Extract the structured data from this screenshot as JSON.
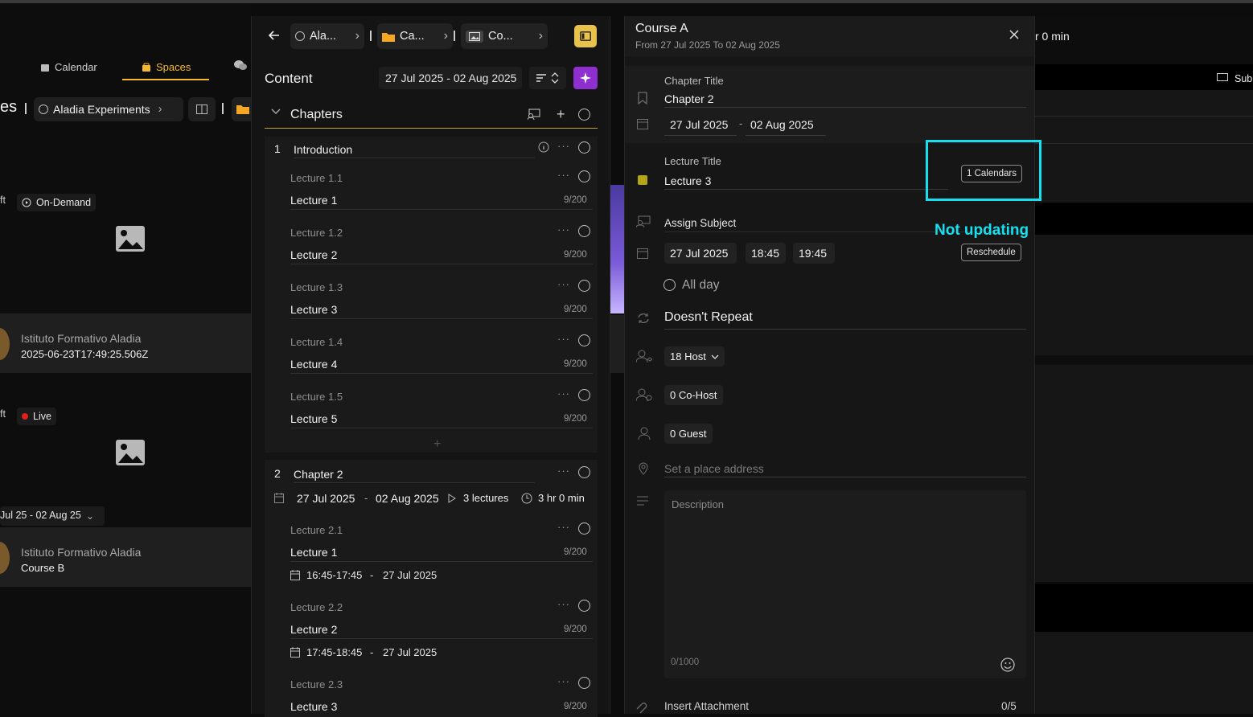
{
  "background": {
    "nav": {
      "calendar": "Calendar",
      "spaces": "Spaces"
    },
    "breadcrumb": {
      "title_fragment": "es",
      "space": "Aladia Experiments"
    },
    "items": [
      {
        "tag_prefix": "ft",
        "tag": "On-Demand",
        "org": "Istituto Formativo Aladia",
        "subtitle": "2025-06-23T17:49:25.506Z"
      },
      {
        "tag_prefix": "ft",
        "tag": "Live",
        "date_range": "Jul 25 - 02 Aug 25",
        "org": "Istituto Formativo Aladia",
        "subtitle": "Course B"
      }
    ],
    "right_fragments": {
      "duration": "r 0 min",
      "sub": "Sub"
    }
  },
  "middle": {
    "breadcrumbs": [
      "Ala...",
      "Ca...",
      "Co..."
    ],
    "header": {
      "title": "Content",
      "date_range": "27 Jul 2025 - 02 Aug 2025"
    },
    "chapters_label": "Chapters",
    "chapter1": {
      "number": "1",
      "title": "Introduction",
      "lectures": [
        {
          "code": "Lecture 1.1",
          "name": "Lecture 1",
          "count": "9/200"
        },
        {
          "code": "Lecture 1.2",
          "name": "Lecture 2",
          "count": "9/200"
        },
        {
          "code": "Lecture 1.3",
          "name": "Lecture 3",
          "count": "9/200"
        },
        {
          "code": "Lecture 1.4",
          "name": "Lecture 4",
          "count": "9/200"
        },
        {
          "code": "Lecture 1.5",
          "name": "Lecture 5",
          "count": "9/200"
        }
      ]
    },
    "chapter2": {
      "number": "2",
      "title": "Chapter 2",
      "start": "27 Jul 2025",
      "dash": "-",
      "end": "02 Aug 2025",
      "lectures_count": "3 lectures",
      "duration": "3 hr 0 min",
      "lectures": [
        {
          "code": "Lecture 2.1",
          "name": "Lecture 1",
          "count": "9/200",
          "time": "16:45-17:45",
          "dash": "-",
          "date": "27 Jul 2025"
        },
        {
          "code": "Lecture 2.2",
          "name": "Lecture 2",
          "count": "9/200",
          "time": "17:45-18:45",
          "dash": "-",
          "date": "27 Jul 2025"
        },
        {
          "code": "Lecture 2.3",
          "name": "Lecture 3",
          "count": "9/200"
        }
      ]
    }
  },
  "right": {
    "title": "Course A",
    "subtitle": "From 27 Jul 2025 To 02 Aug 2025",
    "chapter": {
      "label": "Chapter Title",
      "value": "Chapter 2",
      "start": "27 Jul 2025",
      "dash": "-",
      "end": "02 Aug 2025"
    },
    "lecture": {
      "label": "Lecture Title",
      "value": "Lecture 3",
      "calendars_button": "1 Calendars"
    },
    "assign_subject": "Assign Subject",
    "annotation": "Not updating",
    "schedule": {
      "date": "27 Jul 2025",
      "start": "18:45",
      "end": "19:45",
      "reschedule": "Reschedule"
    },
    "all_day": "All day",
    "repeat": "Doesn't Repeat",
    "host": "18  Host",
    "cohost": "0  Co-Host",
    "guest": "0  Guest",
    "place_placeholder": "Set a place address",
    "description_placeholder": "Description",
    "description_count": "0/1000",
    "attachment_label": "Insert Attachment",
    "attachment_count": "0/5"
  },
  "colors": {
    "accent": "#f5b82e",
    "highlight": "#16e0f0",
    "magic": "#9b3bd6",
    "lecture_color": "#b5a418"
  }
}
